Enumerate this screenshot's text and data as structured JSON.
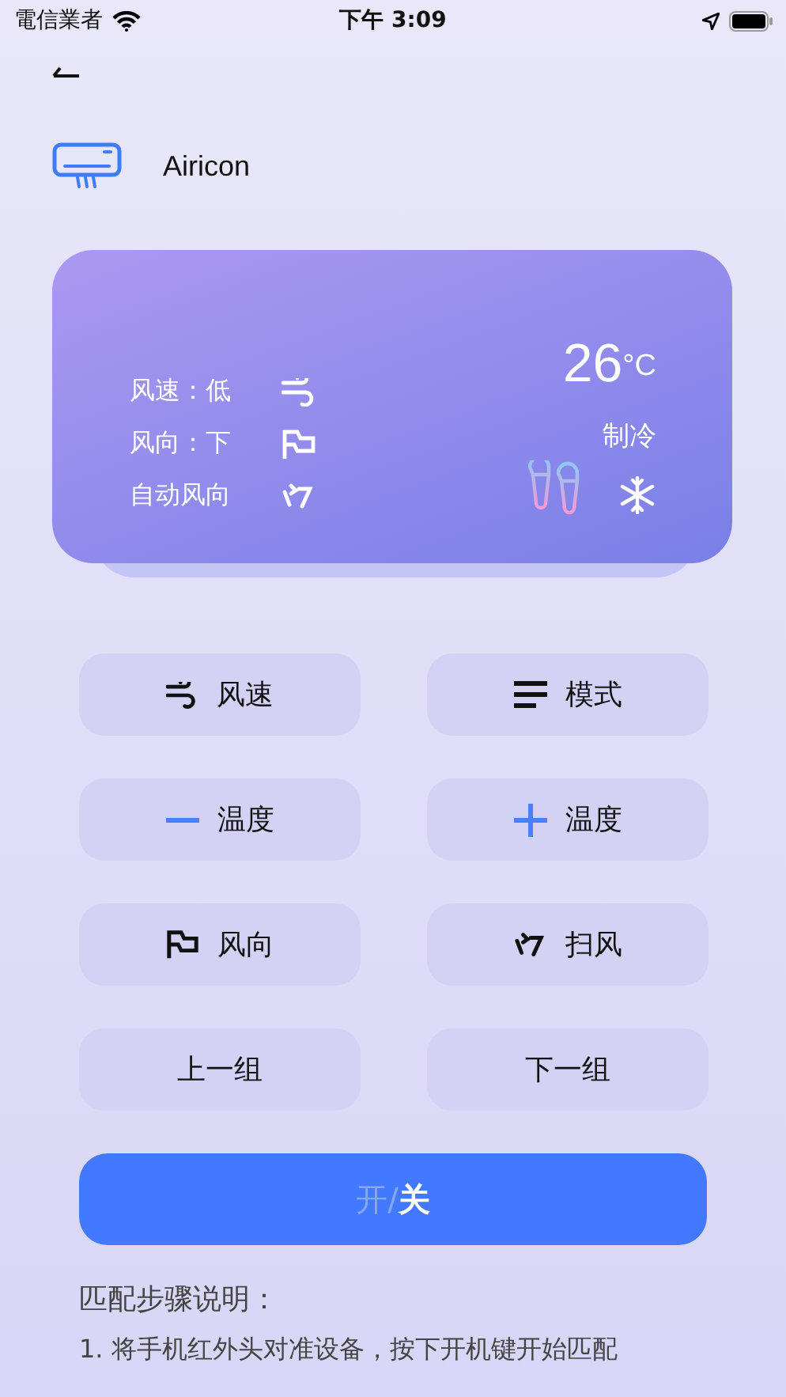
{
  "status_bar": {
    "carrier": "電信業者",
    "time": "下午 3:09"
  },
  "device": {
    "name": "Airicon"
  },
  "card": {
    "rows": [
      {
        "label": "风速：低",
        "kind": "wind"
      },
      {
        "label": "风向：下",
        "kind": "flag"
      },
      {
        "label": "自动风向",
        "kind": "swing"
      }
    ],
    "temperature": "26",
    "unit": "°C",
    "mode": "制冷"
  },
  "buttons": [
    {
      "label": "风速",
      "kind": "wind"
    },
    {
      "label": "模式",
      "kind": "menu"
    },
    {
      "label": "温度",
      "kind": "minus"
    },
    {
      "label": "温度",
      "kind": "plus"
    },
    {
      "label": "风向",
      "kind": "flag"
    },
    {
      "label": "扫风",
      "kind": "swing"
    },
    {
      "label": "上一组",
      "kind": "text"
    },
    {
      "label": "下一组",
      "kind": "text"
    }
  ],
  "power": {
    "options": [
      {
        "label": "开",
        "selected": false
      },
      {
        "label": "关",
        "selected": true
      }
    ],
    "separator": "/"
  },
  "instructions": {
    "title": "匹配步骤说明：",
    "steps": [
      "1. 将手机红外头对准设备，按下开机键开始匹配"
    ]
  }
}
